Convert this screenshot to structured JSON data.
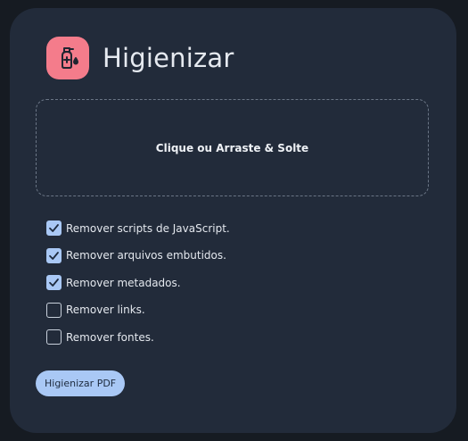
{
  "app": {
    "title": "Higienizar",
    "icon": "sanitizer-bottle-icon",
    "icon_color": "#f47c8b"
  },
  "dropzone": {
    "label": "Clique ou Arraste & Solte"
  },
  "options": [
    {
      "label": "Remover scripts de JavaScript.",
      "checked": true
    },
    {
      "label": "Remover arquivos embutidos.",
      "checked": true
    },
    {
      "label": "Remover metadados.",
      "checked": true
    },
    {
      "label": "Remover links.",
      "checked": false
    },
    {
      "label": "Remover fontes.",
      "checked": false
    }
  ],
  "actions": {
    "submit_label": "Higienizar PDF"
  },
  "colors": {
    "background": "#161b22",
    "card": "#222b3a",
    "accent": "#a9c8f5"
  }
}
